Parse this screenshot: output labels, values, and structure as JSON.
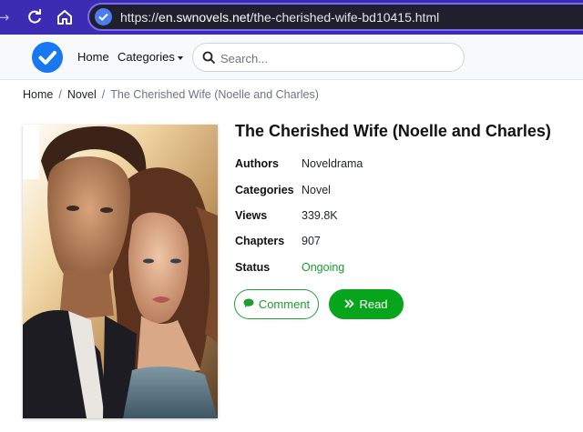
{
  "browser": {
    "url_scheme": "https://",
    "url_host": "en.swnovels.net",
    "url_path": "/the-cherished-wife-bd10415.html"
  },
  "header": {
    "nav_home": "Home",
    "nav_categories": "Categories",
    "search_placeholder": "Search..."
  },
  "breadcrumb": {
    "items": [
      "Home",
      "Novel",
      "The Cherished Wife (Noelle and Charles)"
    ],
    "separator": "/"
  },
  "book": {
    "title": "The Cherished Wife (Noelle and Charles)",
    "details": [
      {
        "label": "Authors",
        "value": "Noveldrama"
      },
      {
        "label": "Categories",
        "value": "Novel"
      },
      {
        "label": "Views",
        "value": "339.8K"
      },
      {
        "label": "Chapters",
        "value": "907"
      },
      {
        "label": "Status",
        "value": "Ongoing"
      }
    ],
    "comment_label": "Comment",
    "read_label": "Read"
  },
  "colors": {
    "chrome_bg": "#3c2bb3",
    "brand_blue": "#1778f2",
    "read_green": "#07a51c",
    "status_green": "#1a9a2c"
  },
  "icons": {
    "forward": "arrow-right-icon",
    "reload": "reload-icon",
    "home": "home-icon",
    "site": "site-security-icon",
    "logo": "check-circle-logo",
    "search": "search-icon",
    "comment": "comment-icon",
    "read": "double-chevron-right-icon"
  }
}
